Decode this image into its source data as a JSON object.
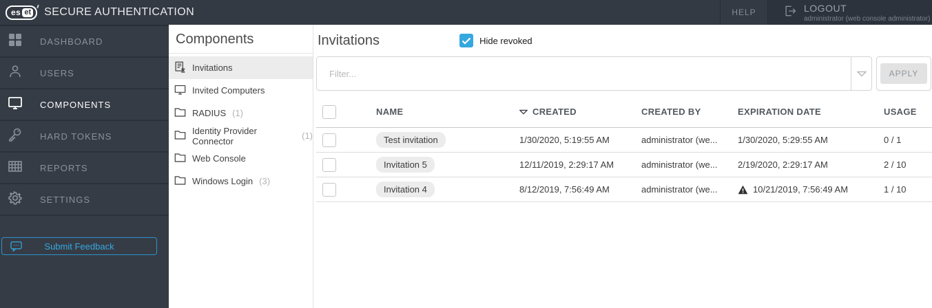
{
  "topbar": {
    "logo_left": "es",
    "logo_right": "et",
    "brand": "SECURE AUTHENTICATION",
    "help_label": "HELP",
    "logout_label": "LOGOUT",
    "logout_sub": "administrator (web console administrator)"
  },
  "sidebar": {
    "items": [
      {
        "label": "DASHBOARD",
        "icon": "dashboard-icon",
        "active": false
      },
      {
        "label": "USERS",
        "icon": "user-icon",
        "active": false
      },
      {
        "label": "COMPONENTS",
        "icon": "monitor-icon",
        "active": true
      },
      {
        "label": "HARD TOKENS",
        "icon": "key-icon",
        "active": false
      },
      {
        "label": "REPORTS",
        "icon": "report-grid-icon",
        "active": false
      },
      {
        "label": "SETTINGS",
        "icon": "gear-icon",
        "active": false
      }
    ],
    "feedback_label": "Submit Feedback"
  },
  "components_panel": {
    "title": "Components",
    "items": [
      {
        "label": "Invitations",
        "count": "",
        "icon": "invitation-list-icon",
        "selected": true
      },
      {
        "label": "Invited Computers",
        "count": "",
        "icon": "monitor-icon",
        "selected": false
      },
      {
        "label": "RADIUS",
        "count": "(1)",
        "icon": "folder-icon",
        "selected": false
      },
      {
        "label": "Identity Provider Connector",
        "count": "(1)",
        "icon": "folder-icon",
        "selected": false
      },
      {
        "label": "Web Console",
        "count": "",
        "icon": "folder-icon",
        "selected": false
      },
      {
        "label": "Windows Login",
        "count": "(3)",
        "icon": "folder-icon",
        "selected": false
      }
    ]
  },
  "main": {
    "title": "Invitations",
    "hide_revoked": {
      "label": "Hide revoked",
      "checked": true
    },
    "filter": {
      "placeholder": "Filter...",
      "value": "",
      "dropdown_icon": "chevron-down-icon"
    },
    "apply_label": "APPLY",
    "table": {
      "columns": [
        "NAME",
        "CREATED",
        "CREATED BY",
        "EXPIRATION DATE",
        "USAGE"
      ],
      "sorted_by": "CREATED",
      "sort_direction": "desc",
      "rows": [
        {
          "name": "Test invitation",
          "created": "1/30/2020, 5:19:55 AM",
          "created_by": "administrator (we...",
          "expiration": "1/30/2020, 5:29:55 AM",
          "expiration_warning": false,
          "usage": "0 / 1",
          "checked": false
        },
        {
          "name": "Invitation 5",
          "created": "12/11/2019, 2:29:17 AM",
          "created_by": "administrator (we...",
          "expiration": "2/19/2020, 2:29:17 AM",
          "expiration_warning": false,
          "usage": "2 / 10",
          "checked": false
        },
        {
          "name": "Invitation 4",
          "created": "8/12/2019, 7:56:49 AM",
          "created_by": "administrator (we...",
          "expiration": "10/21/2019, 7:56:49 AM",
          "expiration_warning": true,
          "usage": "1 / 10",
          "checked": false
        }
      ]
    }
  },
  "colors": {
    "accent_blue": "#35a8e0",
    "topbar_bg": "#343a43",
    "sidebar_bg": "#363c45",
    "logout_bg": "#2d333c",
    "selected_item_bg": "#ececec",
    "name_badge_bg": "#ececec"
  }
}
